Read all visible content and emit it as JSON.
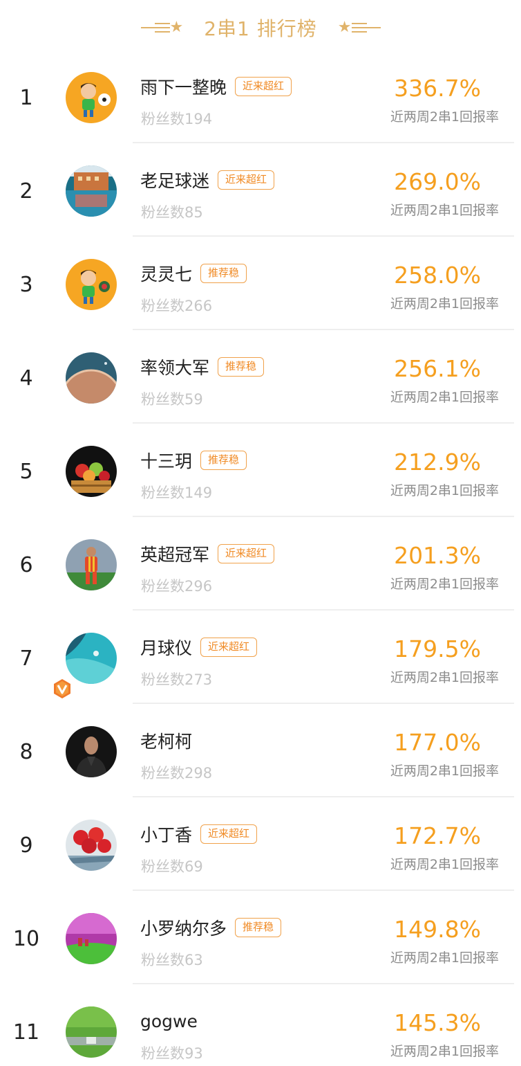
{
  "header": {
    "title": "2串1 排行榜"
  },
  "rate_label": "近两周2串1回报率",
  "rows": [
    {
      "rank": "1",
      "name": "雨下一整晚",
      "tag": "近来超红",
      "fans": "粉丝数194",
      "rate": "336.7%",
      "avatar_icon": "cartoon-soccer-boy-avatar"
    },
    {
      "rank": "2",
      "name": "老足球迷",
      "tag": "近来超红",
      "fans": "粉丝数85",
      "rate": "269.0%",
      "avatar_icon": "building-reflection-avatar"
    },
    {
      "rank": "3",
      "name": "灵灵七",
      "tag": "推荐稳",
      "fans": "粉丝数266",
      "rate": "258.0%",
      "avatar_icon": "cartoon-soccer-boy-avatar"
    },
    {
      "rank": "4",
      "name": "率领大军",
      "tag": "推荐稳",
      "fans": "粉丝数59",
      "rate": "256.1%",
      "avatar_icon": "planet-avatar"
    },
    {
      "rank": "5",
      "name": "十三玥",
      "tag": "推荐稳",
      "fans": "粉丝数149",
      "rate": "212.9%",
      "avatar_icon": "fruit-basket-avatar"
    },
    {
      "rank": "6",
      "name": "英超冠军",
      "tag": "近来超红",
      "fans": "粉丝数296",
      "rate": "201.3%",
      "avatar_icon": "soccer-player-avatar"
    },
    {
      "rank": "7",
      "name": "月球仪",
      "tag": "近来超红",
      "fans": "粉丝数273",
      "rate": "179.5%",
      "avatar_icon": "ocean-aerial-avatar",
      "verified": true
    },
    {
      "rank": "8",
      "name": "老柯柯",
      "tag": "",
      "fans": "粉丝数298",
      "rate": "177.0%",
      "avatar_icon": "man-portrait-avatar"
    },
    {
      "rank": "9",
      "name": "小丁香",
      "tag": "近来超红",
      "fans": "粉丝数69",
      "rate": "172.7%",
      "avatar_icon": "strawberries-avatar"
    },
    {
      "rank": "10",
      "name": "小罗纳尔多",
      "tag": "推荐稳",
      "fans": "粉丝数63",
      "rate": "149.8%",
      "avatar_icon": "purple-sky-landscape-avatar"
    },
    {
      "rank": "11",
      "name": "gogwe",
      "tag": "",
      "fans": "粉丝数93",
      "rate": "145.3%",
      "avatar_icon": "grass-field-avatar"
    }
  ],
  "colors": {
    "accent_gold": "#e0b36a",
    "rate_orange": "#f59f1f",
    "tag_border": "#f0a14a",
    "tag_text": "#f08a24"
  }
}
